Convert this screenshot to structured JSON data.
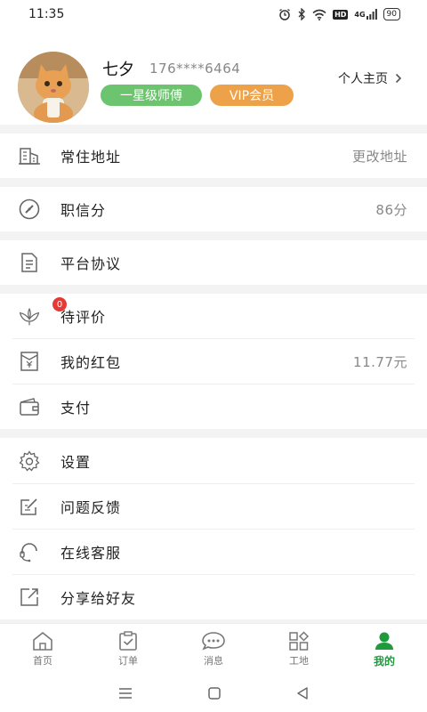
{
  "status_bar": {
    "time": "11:35",
    "network_label": "4G",
    "hd_label": "HD",
    "battery": "90",
    "icons": [
      "alarm-icon",
      "bluetooth-icon",
      "wifi-icon",
      "hd-icon",
      "signal-icon",
      "battery-icon"
    ]
  },
  "profile": {
    "name": "七夕",
    "phone": "176****6464",
    "level_badge": "一星级师傅",
    "vip_badge": "VIP会员",
    "homepage_label": "个人主页",
    "colors": {
      "level": "#6dc46f",
      "vip": "#eda24a"
    }
  },
  "menu": {
    "address": {
      "label": "常住地址",
      "value": "更改地址",
      "icon": "building-icon"
    },
    "credit": {
      "label": "职信分",
      "value": "86分",
      "icon": "gauge-icon"
    },
    "agreement": {
      "label": "平台协议",
      "icon": "document-icon"
    },
    "review": {
      "label": "待评价",
      "badge": "0",
      "icon": "flower-icon"
    },
    "redpacket": {
      "label": "我的红包",
      "value": "11.77元",
      "icon": "redpacket-icon"
    },
    "payment": {
      "label": "支付",
      "icon": "wallet-icon"
    },
    "settings": {
      "label": "设置",
      "icon": "gear-icon"
    },
    "feedback": {
      "label": "问题反馈",
      "icon": "edit-icon"
    },
    "service": {
      "label": "在线客服",
      "icon": "headset-icon"
    },
    "share": {
      "label": "分享给好友",
      "icon": "share-icon"
    }
  },
  "tabbar": {
    "items": [
      {
        "label": "首页",
        "icon": "home-icon"
      },
      {
        "label": "订单",
        "icon": "clipboard-icon"
      },
      {
        "label": "消息",
        "icon": "chat-icon"
      },
      {
        "label": "工地",
        "icon": "grid-icon"
      },
      {
        "label": "我的",
        "icon": "person-icon",
        "active": true
      }
    ],
    "active_color": "#1f9a3c"
  }
}
